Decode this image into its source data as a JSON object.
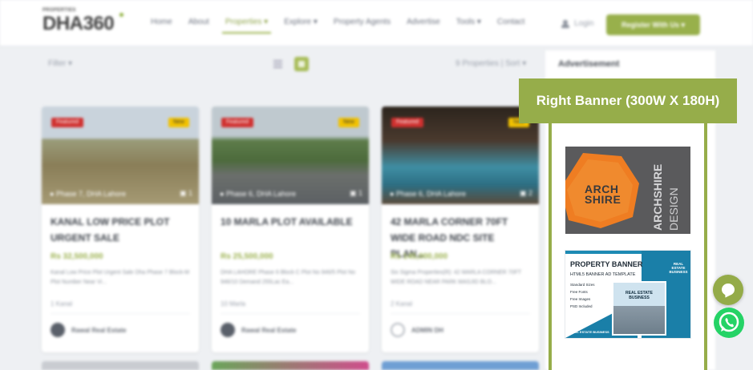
{
  "brand": {
    "small": "PROPERTIES",
    "name": "DHA360"
  },
  "nav": {
    "items": [
      "Home",
      "About",
      "Properties ▾",
      "Explore ▾",
      "Property Agents",
      "Advertise",
      "Tools ▾",
      "Contact"
    ],
    "active_index": 2,
    "login": "Login",
    "register": "Register With Us ▾"
  },
  "toolbar": {
    "filter": "Filter ▾",
    "sort": "9 Properties | Sort ▾"
  },
  "sidebar": {
    "title": "Advertisement"
  },
  "cards": [
    {
      "featured": "Featured",
      "new": "New",
      "location": "Phase 7, DHA Lahore",
      "photo_count": "1",
      "title": "KANAL LOW PRICE PLOT URGENT SALE",
      "price": "Rs 32,500,000",
      "description": "Kanal Low Price Plot Urgent Sale Dha Phase 7 Block-M Plot Number Near Vi...",
      "size": "1 Kanal",
      "agent": "Rawal Real Estate"
    },
    {
      "featured": "Featured",
      "new": "New",
      "location": "Phase 6, DHA Lahore",
      "photo_count": "1",
      "title": "10 MARLA PLOT AVAILABLE",
      "price": "Rs 25,500,000",
      "description": "DHA LAHORE Phase 6 Block C Plot No 946/5 Plot No 946/10 Demand 255Lac Ea...",
      "size": "10 Marla",
      "agent": "Rawal Real Estate"
    },
    {
      "featured": "Featured",
      "new": "New",
      "location": "Phase 6, DHA Lahore",
      "photo_count": "2",
      "title": "42 MARLA CORNER 70FT WIDE ROAD NDC SITE PLAN...",
      "price": "Rs 145,000,000",
      "description": "Six Sigma Properties(R): 42 MARLA CORNER 70FT WIDE ROAD NEAR PARK MASJID BLO...",
      "size": "2 Kanal",
      "agent": "ADMIN DH"
    }
  ],
  "ad_overlay": {
    "label": "Right Banner (300W X 180H)",
    "ad1": {
      "line1": "ARCH",
      "line2": "SHIRE",
      "vertical1": "ARCHSHIRE",
      "vertical2": "DESIGN"
    },
    "ad2": {
      "title": "PROPERTY BANNER",
      "subtitle": "HTML5 BANNER AD TEMPLATE",
      "features": [
        "Standard Sizes",
        "Free Fonts",
        "Free Images",
        "PSD Included"
      ],
      "photo_label": "REAL ESTATE BUSINESS",
      "side_label": "REAL ESTATE BUSINESS",
      "bottom_label": "REAL ESTATE BUSINESS"
    }
  },
  "colors": {
    "accent": "#96ad4a",
    "featured": "#d0302f",
    "new": "#f2c200",
    "whatsapp": "#25d366"
  }
}
